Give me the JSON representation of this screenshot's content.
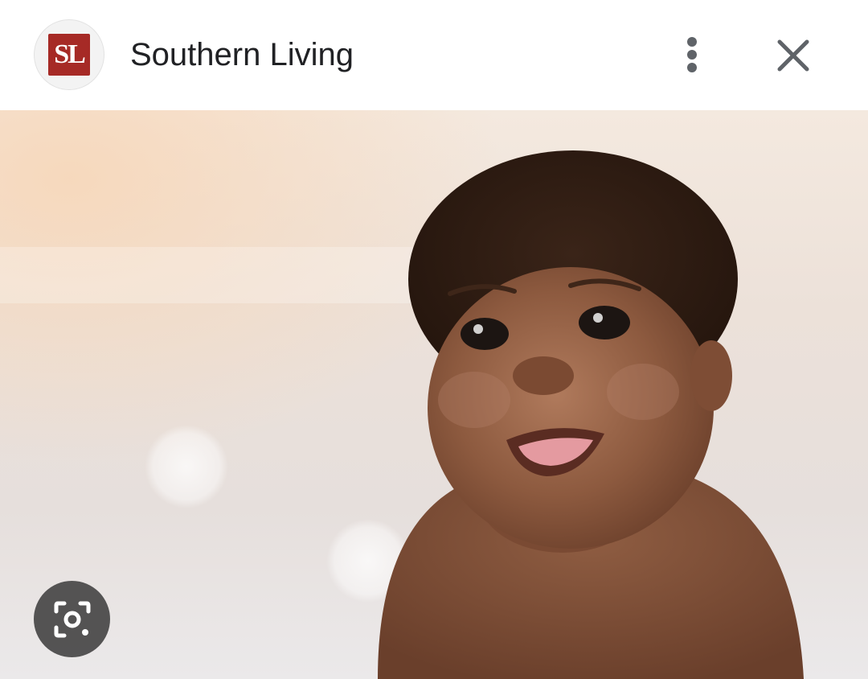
{
  "header": {
    "logo": {
      "text": "SL",
      "color": "#a62a26",
      "icon": "southern-living-logo"
    },
    "site_name": "Southern Living",
    "more_icon": "more-vert-icon",
    "close_icon": "close-icon"
  },
  "image": {
    "subject": "smiling baby photo",
    "lens_icon": "google-lens-camera-icon"
  },
  "colors": {
    "header_bg": "#ffffff",
    "title_text": "#202124",
    "icon_gray": "#5f6368",
    "lens_button_bg": "#464646"
  }
}
